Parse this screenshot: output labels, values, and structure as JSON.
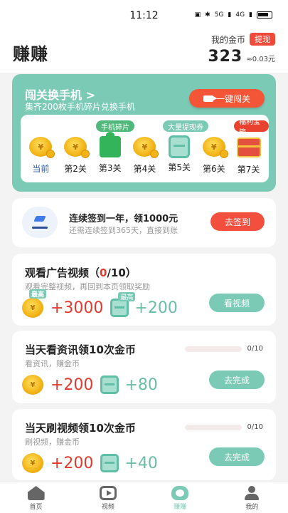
{
  "status": {
    "time": "11:12",
    "signal_label": "5G",
    "signal_label2": "4G"
  },
  "header": {
    "title": "赚赚",
    "coin_label": "我的金币",
    "withdraw_label": "提现",
    "coin_value": "323",
    "coin_rmb": "≈0.03元"
  },
  "challenge": {
    "title": "闯关换手机 >",
    "subtitle": "集齐200枚手机碎片兑换手机",
    "button_label": "一键闯关",
    "tags": {
      "phone_fragment": "手机碎片",
      "withdraw_ticket": "大量提现券",
      "treasure_box": "福利宝箱"
    },
    "levels": [
      {
        "label": "当前",
        "icon": "coin-icon"
      },
      {
        "label": "第2关",
        "icon": "coin-icon"
      },
      {
        "label": "第3关",
        "icon": "puzzle-piece-icon"
      },
      {
        "label": "第4关",
        "icon": "coin-icon"
      },
      {
        "label": "第5关",
        "icon": "ticket-icon"
      },
      {
        "label": "第6关",
        "icon": "coin-icon"
      },
      {
        "label": "第7关",
        "icon": "treasure-chest-icon"
      }
    ]
  },
  "signin": {
    "title": "连续签到一年，领1000元",
    "subtitle": "还需连续签到365天，直接到账",
    "button_label": "去签到"
  },
  "tasks": [
    {
      "title_prefix": "观看广告视频（",
      "title_count": "0",
      "title_suffix": "/10）",
      "subtitle": "观看完整视频，再回到本页领取奖励",
      "badge_coin": "最高",
      "reward_coin": "+3000",
      "badge_ticket": "最高",
      "reward_ticket": "+200",
      "button_label": "看视频"
    },
    {
      "title": "当天看资讯领10次金币",
      "progress": "0/10",
      "subtitle": "看资讯，赚金币",
      "reward_coin": "+200",
      "reward_ticket": "+80",
      "button_label": "去完成"
    },
    {
      "title": "当天刷视频领10次金币",
      "progress": "0/10",
      "subtitle": "刷视频，赚金币",
      "reward_coin": "+200",
      "reward_ticket": "+40",
      "button_label": "去完成"
    }
  ],
  "coin_symbol": "¥",
  "tabbar": [
    {
      "label": "首页",
      "icon": "home-icon"
    },
    {
      "label": "视频",
      "icon": "video-play-icon"
    },
    {
      "label": "赚赚",
      "icon": "earn-icon"
    },
    {
      "label": "我的",
      "icon": "profile-icon"
    }
  ],
  "colors": {
    "accent": "#7bcab5",
    "red": "#f24f3f",
    "current_level": "#2f5fa8"
  }
}
